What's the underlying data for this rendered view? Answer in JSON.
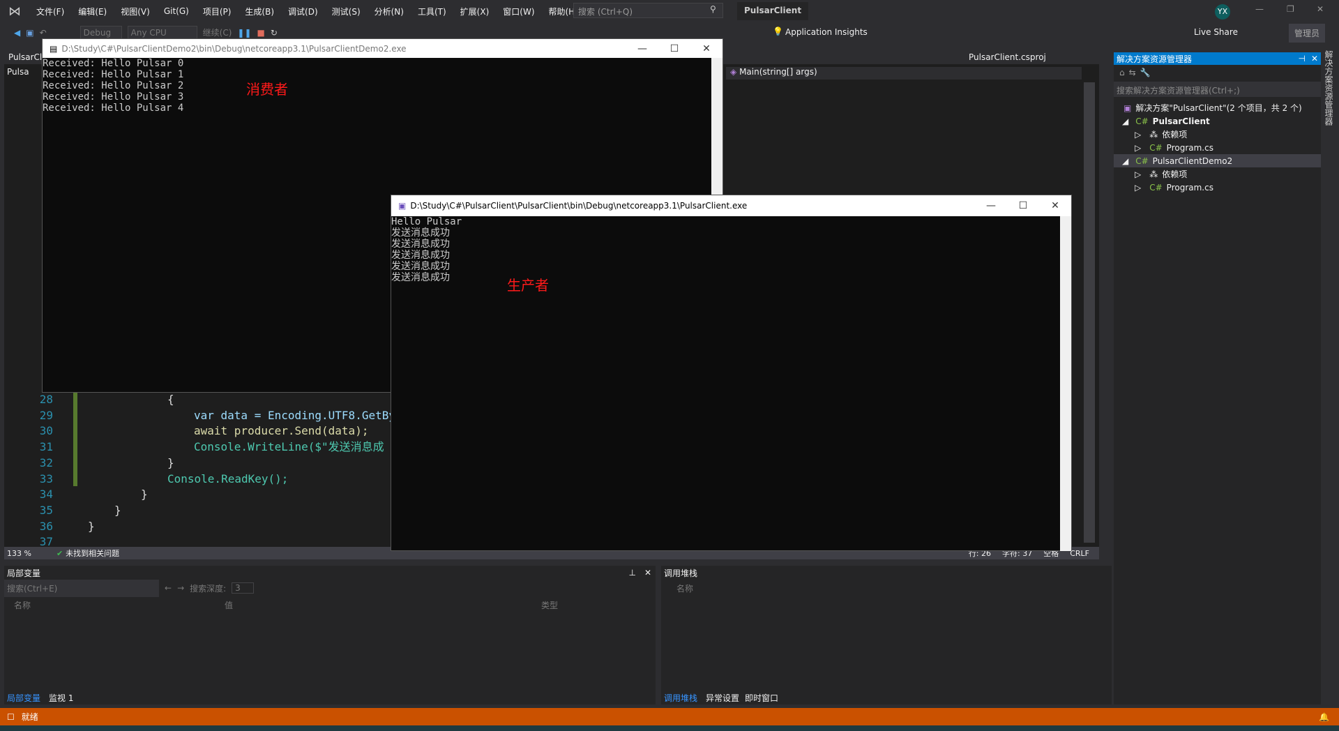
{
  "menu": {
    "items": [
      "文件(F)",
      "编辑(E)",
      "视图(V)",
      "Git(G)",
      "项目(P)",
      "生成(B)",
      "调试(D)",
      "测试(S)",
      "分析(N)",
      "工具(T)",
      "扩展(X)",
      "窗口(W)",
      "帮助(H)"
    ],
    "search_placeholder": "搜索 (Ctrl+Q)",
    "project": "PulsarClient",
    "user": "YX"
  },
  "toolbar": {
    "config": "Debug",
    "platform": "Any CPU",
    "continue": "继续(C)",
    "insights": "Application Insights",
    "live_share": "Live Share",
    "admin": "管理员"
  },
  "editor": {
    "tab": "PulsarCl",
    "file_tab": "Pulsa",
    "csproj": "PulsarClient.csproj",
    "member": "Main(string[] args)",
    "lines": [
      {
        "n": "28",
        "code": "{"
      },
      {
        "n": "29",
        "code": "var data = Encoding.UTF8.GetBy"
      },
      {
        "n": "30",
        "code": "await producer.Send(data);"
      },
      {
        "n": "31",
        "code": "Console.WriteLine($\"发送消息成"
      },
      {
        "n": "32",
        "code": "}"
      },
      {
        "n": "33",
        "code": "Console.ReadKey();"
      },
      {
        "n": "34",
        "code": "}"
      },
      {
        "n": "35",
        "code": "}"
      },
      {
        "n": "36",
        "code": "}"
      },
      {
        "n": "37",
        "code": ""
      }
    ],
    "zoom": "133 %",
    "issues": "未找到相关问题",
    "row": "行: 26",
    "col": "字符: 37",
    "spaces": "空格",
    "eol": "CRLF"
  },
  "consumer": {
    "title": "D:\\Study\\C#\\PulsarClientDemo2\\bin\\Debug\\netcoreapp3.1\\PulsarClientDemo2.exe",
    "lines": [
      "Received: Hello Pulsar 0",
      "Received: Hello Pulsar 1",
      "Received: Hello Pulsar 2",
      "Received: Hello Pulsar 3",
      "Received: Hello Pulsar 4"
    ],
    "label": "消费者"
  },
  "producer": {
    "title": "D:\\Study\\C#\\PulsarClient\\PulsarClient\\bin\\Debug\\netcoreapp3.1\\PulsarClient.exe",
    "lines": [
      "Hello Pulsar",
      "发送消息成功",
      "发送消息成功",
      "发送消息成功",
      "发送消息成功",
      "发送消息成功"
    ],
    "label": "生产者"
  },
  "solution_explorer": {
    "title": "解决方案资源管理器",
    "search": "搜索解决方案资源管理器(Ctrl+;)",
    "solution": "解决方案\"PulsarClient\"(2 个项目，共 2 个)",
    "projects": [
      {
        "name": "PulsarClient",
        "deps": "依赖项",
        "file": "Program.cs"
      },
      {
        "name": "PulsarClientDemo2",
        "deps": "依赖项",
        "file": "Program.cs"
      }
    ],
    "side_tab": "解决方案资源管理器"
  },
  "locals": {
    "title": "局部变量",
    "search": "搜索(Ctrl+E)",
    "depth_label": "搜索深度:",
    "depth": "3",
    "cols": [
      "名称",
      "值",
      "类型"
    ],
    "tabs": [
      "局部变量",
      "监视 1"
    ]
  },
  "callstack": {
    "title": "调用堆栈",
    "cols": [
      "名称"
    ],
    "tabs": [
      "调用堆栈",
      "异常设置",
      "即时窗口"
    ]
  },
  "status": {
    "text": "就绪"
  },
  "colors": {
    "accent": "#007acc",
    "status": "#ca5100"
  }
}
